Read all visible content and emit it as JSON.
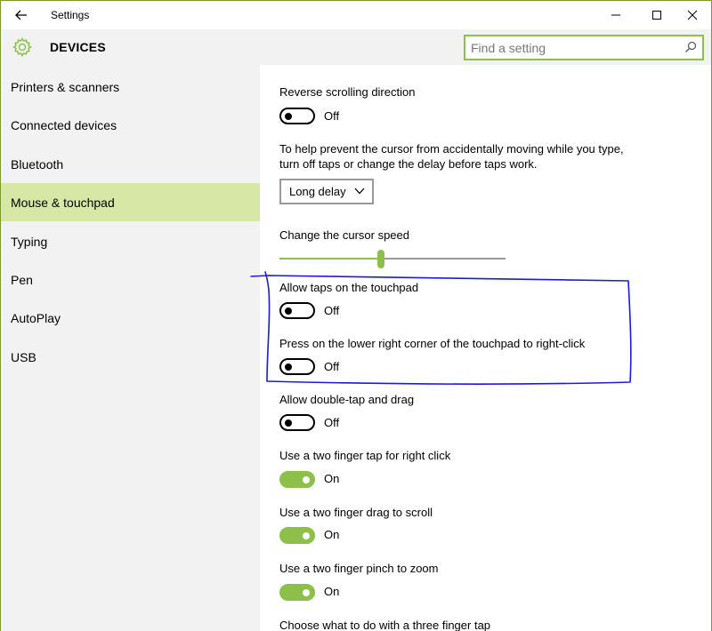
{
  "window": {
    "title": "Settings"
  },
  "header": {
    "title": "DEVICES",
    "search_placeholder": "Find a setting"
  },
  "sidebar": {
    "items": [
      {
        "label": "Printers & scanners",
        "selected": false
      },
      {
        "label": "Connected devices",
        "selected": false
      },
      {
        "label": "Bluetooth",
        "selected": false
      },
      {
        "label": "Mouse & touchpad",
        "selected": true
      },
      {
        "label": "Typing",
        "selected": false
      },
      {
        "label": "Pen",
        "selected": false
      },
      {
        "label": "AutoPlay",
        "selected": false
      },
      {
        "label": "USB",
        "selected": false
      }
    ]
  },
  "main": {
    "reverse_scrolling": {
      "label": "Reverse scrolling direction",
      "state": "Off",
      "on": false
    },
    "tap_delay": {
      "description": "To help prevent the cursor from accidentally moving while you type, turn off taps or change the delay before taps work.",
      "selected_option": "Long delay"
    },
    "cursor_speed": {
      "label": "Change the cursor speed",
      "value_fraction": 0.45
    },
    "allow_taps": {
      "label": "Allow taps on the touchpad",
      "state": "Off",
      "on": false
    },
    "right_click_corner": {
      "label": "Press on the lower right corner of the touchpad to right-click",
      "state": "Off",
      "on": false
    },
    "double_tap_drag": {
      "label": "Allow double-tap and drag",
      "state": "Off",
      "on": false
    },
    "two_finger_right_click": {
      "label": "Use a two finger tap for right click",
      "state": "On",
      "on": true
    },
    "two_finger_scroll": {
      "label": "Use a two finger drag to scroll",
      "state": "On",
      "on": true
    },
    "two_finger_zoom": {
      "label": "Use a two finger pinch to zoom",
      "state": "On",
      "on": true
    },
    "three_finger_tap": {
      "label": "Choose what to do with a three finger tap"
    }
  },
  "colors": {
    "accent": "#8cc04a",
    "selected_nav": "#d6e7a6",
    "annotation": "#1a1ae0"
  }
}
